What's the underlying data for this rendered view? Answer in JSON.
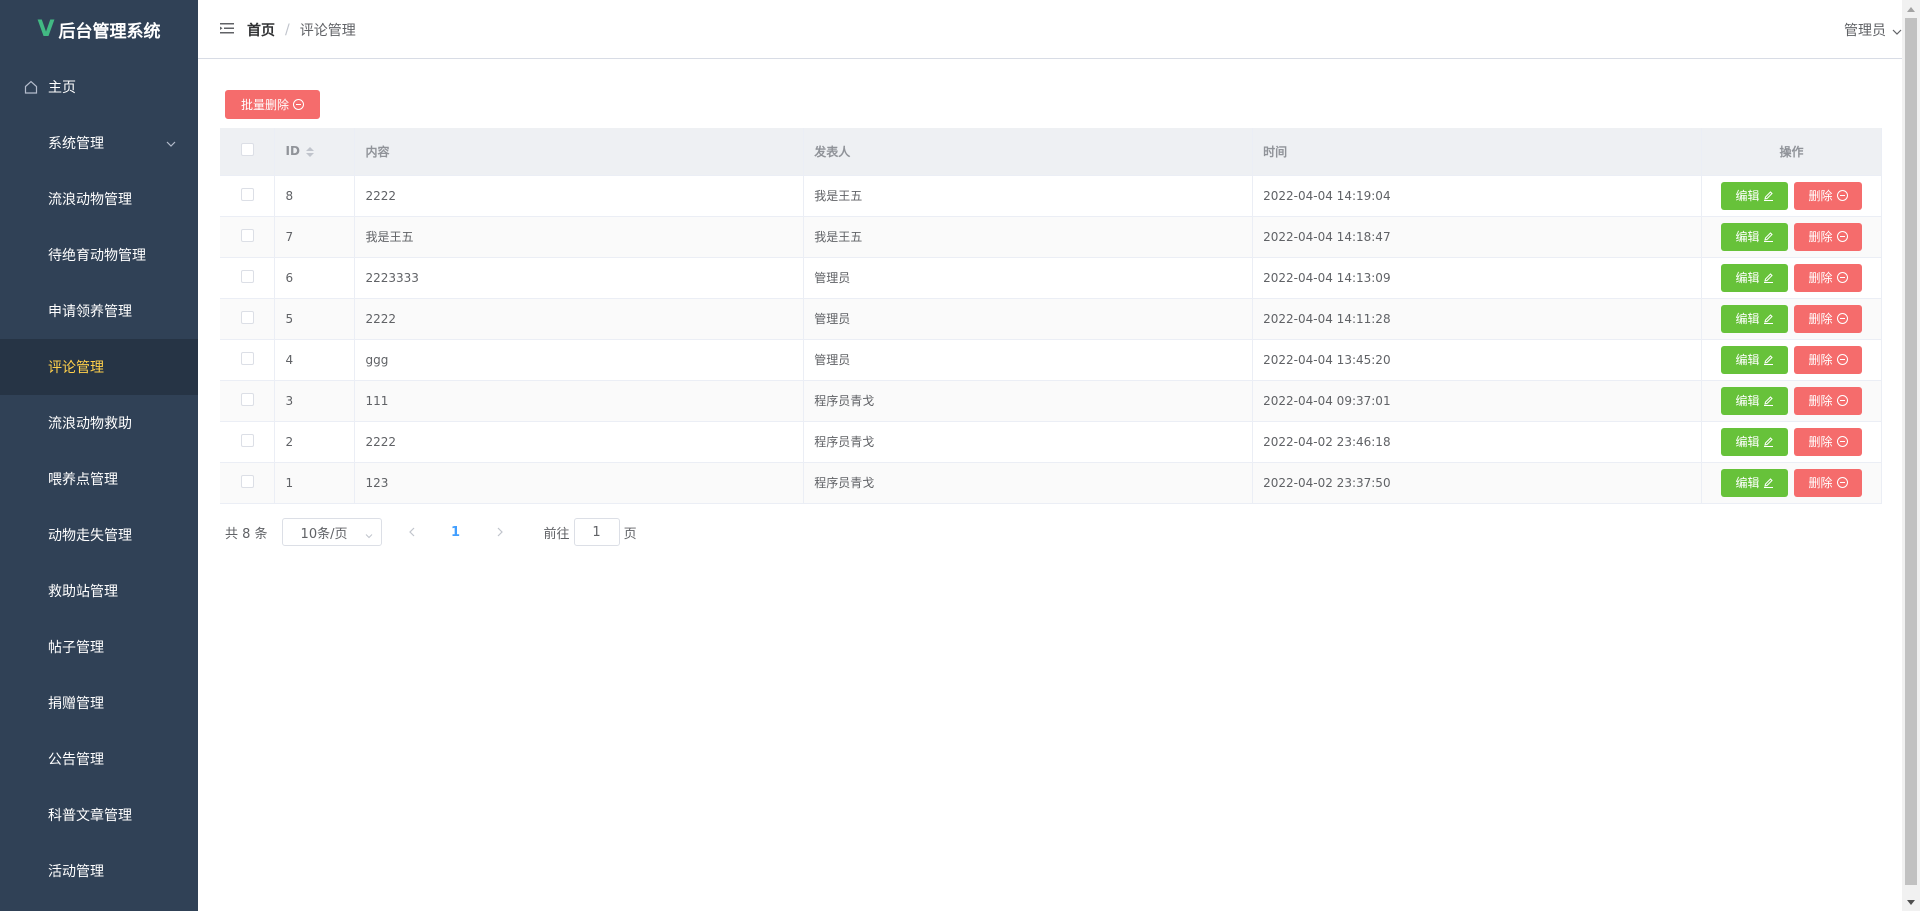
{
  "app": {
    "logo_mark": "V",
    "title": "后台管理系统"
  },
  "sidebar": {
    "items": [
      {
        "label": "主页",
        "icon": "home-icon"
      },
      {
        "label": "系统管理",
        "icon": "nine-grid-icon",
        "expandable": true
      },
      {
        "label": "流浪动物管理",
        "icon": "grid-icon"
      },
      {
        "label": "待绝育动物管理",
        "icon": "grid-icon"
      },
      {
        "label": "申请领养管理",
        "icon": "grid-icon"
      },
      {
        "label": "评论管理",
        "icon": "grid-icon",
        "active": true
      },
      {
        "label": "流浪动物救助",
        "icon": "grid-icon"
      },
      {
        "label": "喂养点管理",
        "icon": "grid-icon"
      },
      {
        "label": "动物走失管理",
        "icon": "grid-icon"
      },
      {
        "label": "救助站管理",
        "icon": "grid-icon"
      },
      {
        "label": "帖子管理",
        "icon": "grid-icon"
      },
      {
        "label": "捐赠管理",
        "icon": "grid-icon"
      },
      {
        "label": "公告管理",
        "icon": "grid-icon"
      },
      {
        "label": "科普文章管理",
        "icon": "grid-icon"
      },
      {
        "label": "活动管理",
        "icon": "grid-icon"
      }
    ]
  },
  "header": {
    "breadcrumb_home": "首页",
    "breadcrumb_sep": "/",
    "breadcrumb_current": "评论管理",
    "user": "管理员"
  },
  "toolbar": {
    "batch_delete": "批量删除"
  },
  "table": {
    "columns": {
      "id": "ID",
      "content": "内容",
      "author": "发表人",
      "time": "时间",
      "ops": "操作"
    },
    "edit_label": "编辑",
    "delete_label": "删除",
    "rows": [
      {
        "id": "8",
        "content": "2222",
        "author": "我是王五",
        "time": "2022-04-04 14:19:04"
      },
      {
        "id": "7",
        "content": "我是王五",
        "author": "我是王五",
        "time": "2022-04-04 14:18:47"
      },
      {
        "id": "6",
        "content": "2223333",
        "author": "管理员",
        "time": "2022-04-04 14:13:09"
      },
      {
        "id": "5",
        "content": "2222",
        "author": "管理员",
        "time": "2022-04-04 14:11:28"
      },
      {
        "id": "4",
        "content": "ggg",
        "author": "管理员",
        "time": "2022-04-04 13:45:20"
      },
      {
        "id": "3",
        "content": "111",
        "author": "程序员青戈",
        "time": "2022-04-04 09:37:01"
      },
      {
        "id": "2",
        "content": "2222",
        "author": "程序员青戈",
        "time": "2022-04-02 23:46:18"
      },
      {
        "id": "1",
        "content": "123",
        "author": "程序员青戈",
        "time": "2022-04-02 23:37:50"
      }
    ]
  },
  "pagination": {
    "total": "共 8 条",
    "page_size": "10条/页",
    "current_page": "1",
    "goto_prefix": "前往",
    "goto_value": "1",
    "goto_suffix": "页"
  },
  "colors": {
    "sidebar_bg": "#304156",
    "active_text": "#ffd04b",
    "edit_btn": "#67c23a",
    "delete_btn": "#f56c6c",
    "page_active": "#409eff"
  }
}
